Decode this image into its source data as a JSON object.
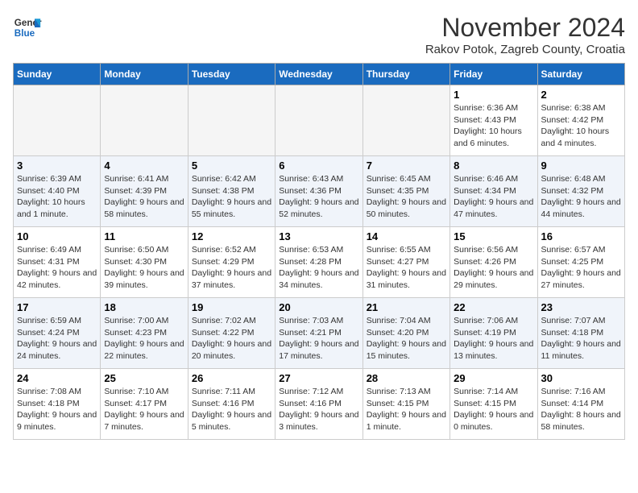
{
  "logo": {
    "line1": "General",
    "line2": "Blue"
  },
  "title": "November 2024",
  "location": "Rakov Potok, Zagreb County, Croatia",
  "weekdays": [
    "Sunday",
    "Monday",
    "Tuesday",
    "Wednesday",
    "Thursday",
    "Friday",
    "Saturday"
  ],
  "weeks": [
    [
      {
        "day": "",
        "empty": true
      },
      {
        "day": "",
        "empty": true
      },
      {
        "day": "",
        "empty": true
      },
      {
        "day": "",
        "empty": true
      },
      {
        "day": "",
        "empty": true
      },
      {
        "day": "1",
        "sunrise": "Sunrise: 6:36 AM",
        "sunset": "Sunset: 4:43 PM",
        "daylight": "Daylight: 10 hours and 6 minutes."
      },
      {
        "day": "2",
        "sunrise": "Sunrise: 6:38 AM",
        "sunset": "Sunset: 4:42 PM",
        "daylight": "Daylight: 10 hours and 4 minutes."
      }
    ],
    [
      {
        "day": "3",
        "sunrise": "Sunrise: 6:39 AM",
        "sunset": "Sunset: 4:40 PM",
        "daylight": "Daylight: 10 hours and 1 minute."
      },
      {
        "day": "4",
        "sunrise": "Sunrise: 6:41 AM",
        "sunset": "Sunset: 4:39 PM",
        "daylight": "Daylight: 9 hours and 58 minutes."
      },
      {
        "day": "5",
        "sunrise": "Sunrise: 6:42 AM",
        "sunset": "Sunset: 4:38 PM",
        "daylight": "Daylight: 9 hours and 55 minutes."
      },
      {
        "day": "6",
        "sunrise": "Sunrise: 6:43 AM",
        "sunset": "Sunset: 4:36 PM",
        "daylight": "Daylight: 9 hours and 52 minutes."
      },
      {
        "day": "7",
        "sunrise": "Sunrise: 6:45 AM",
        "sunset": "Sunset: 4:35 PM",
        "daylight": "Daylight: 9 hours and 50 minutes."
      },
      {
        "day": "8",
        "sunrise": "Sunrise: 6:46 AM",
        "sunset": "Sunset: 4:34 PM",
        "daylight": "Daylight: 9 hours and 47 minutes."
      },
      {
        "day": "9",
        "sunrise": "Sunrise: 6:48 AM",
        "sunset": "Sunset: 4:32 PM",
        "daylight": "Daylight: 9 hours and 44 minutes."
      }
    ],
    [
      {
        "day": "10",
        "sunrise": "Sunrise: 6:49 AM",
        "sunset": "Sunset: 4:31 PM",
        "daylight": "Daylight: 9 hours and 42 minutes."
      },
      {
        "day": "11",
        "sunrise": "Sunrise: 6:50 AM",
        "sunset": "Sunset: 4:30 PM",
        "daylight": "Daylight: 9 hours and 39 minutes."
      },
      {
        "day": "12",
        "sunrise": "Sunrise: 6:52 AM",
        "sunset": "Sunset: 4:29 PM",
        "daylight": "Daylight: 9 hours and 37 minutes."
      },
      {
        "day": "13",
        "sunrise": "Sunrise: 6:53 AM",
        "sunset": "Sunset: 4:28 PM",
        "daylight": "Daylight: 9 hours and 34 minutes."
      },
      {
        "day": "14",
        "sunrise": "Sunrise: 6:55 AM",
        "sunset": "Sunset: 4:27 PM",
        "daylight": "Daylight: 9 hours and 31 minutes."
      },
      {
        "day": "15",
        "sunrise": "Sunrise: 6:56 AM",
        "sunset": "Sunset: 4:26 PM",
        "daylight": "Daylight: 9 hours and 29 minutes."
      },
      {
        "day": "16",
        "sunrise": "Sunrise: 6:57 AM",
        "sunset": "Sunset: 4:25 PM",
        "daylight": "Daylight: 9 hours and 27 minutes."
      }
    ],
    [
      {
        "day": "17",
        "sunrise": "Sunrise: 6:59 AM",
        "sunset": "Sunset: 4:24 PM",
        "daylight": "Daylight: 9 hours and 24 minutes."
      },
      {
        "day": "18",
        "sunrise": "Sunrise: 7:00 AM",
        "sunset": "Sunset: 4:23 PM",
        "daylight": "Daylight: 9 hours and 22 minutes."
      },
      {
        "day": "19",
        "sunrise": "Sunrise: 7:02 AM",
        "sunset": "Sunset: 4:22 PM",
        "daylight": "Daylight: 9 hours and 20 minutes."
      },
      {
        "day": "20",
        "sunrise": "Sunrise: 7:03 AM",
        "sunset": "Sunset: 4:21 PM",
        "daylight": "Daylight: 9 hours and 17 minutes."
      },
      {
        "day": "21",
        "sunrise": "Sunrise: 7:04 AM",
        "sunset": "Sunset: 4:20 PM",
        "daylight": "Daylight: 9 hours and 15 minutes."
      },
      {
        "day": "22",
        "sunrise": "Sunrise: 7:06 AM",
        "sunset": "Sunset: 4:19 PM",
        "daylight": "Daylight: 9 hours and 13 minutes."
      },
      {
        "day": "23",
        "sunrise": "Sunrise: 7:07 AM",
        "sunset": "Sunset: 4:18 PM",
        "daylight": "Daylight: 9 hours and 11 minutes."
      }
    ],
    [
      {
        "day": "24",
        "sunrise": "Sunrise: 7:08 AM",
        "sunset": "Sunset: 4:18 PM",
        "daylight": "Daylight: 9 hours and 9 minutes."
      },
      {
        "day": "25",
        "sunrise": "Sunrise: 7:10 AM",
        "sunset": "Sunset: 4:17 PM",
        "daylight": "Daylight: 9 hours and 7 minutes."
      },
      {
        "day": "26",
        "sunrise": "Sunrise: 7:11 AM",
        "sunset": "Sunset: 4:16 PM",
        "daylight": "Daylight: 9 hours and 5 minutes."
      },
      {
        "day": "27",
        "sunrise": "Sunrise: 7:12 AM",
        "sunset": "Sunset: 4:16 PM",
        "daylight": "Daylight: 9 hours and 3 minutes."
      },
      {
        "day": "28",
        "sunrise": "Sunrise: 7:13 AM",
        "sunset": "Sunset: 4:15 PM",
        "daylight": "Daylight: 9 hours and 1 minute."
      },
      {
        "day": "29",
        "sunrise": "Sunrise: 7:14 AM",
        "sunset": "Sunset: 4:15 PM",
        "daylight": "Daylight: 9 hours and 0 minutes."
      },
      {
        "day": "30",
        "sunrise": "Sunrise: 7:16 AM",
        "sunset": "Sunset: 4:14 PM",
        "daylight": "Daylight: 8 hours and 58 minutes."
      }
    ]
  ]
}
